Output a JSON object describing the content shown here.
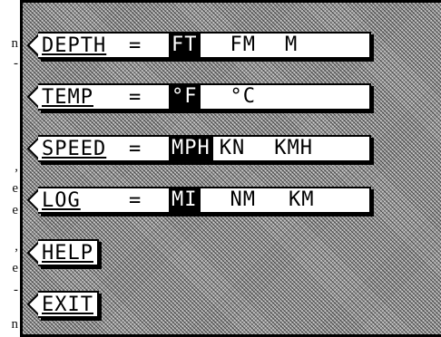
{
  "edge_text": [
    "n",
    "-",
    ",",
    "e",
    "e",
    ",",
    "e",
    "-",
    "n"
  ],
  "menu": {
    "depth": {
      "label": "DEPTH",
      "eq": "=",
      "options": [
        "FT",
        "FM",
        "M"
      ],
      "selected": "FT"
    },
    "temp": {
      "label": "TEMP",
      "eq": "=",
      "options": [
        "°F",
        "°C"
      ],
      "selected": "°F"
    },
    "speed": {
      "label": "SPEED",
      "eq": "=",
      "options": [
        "MPH",
        "KN",
        "KMH"
      ],
      "selected": "MPH"
    },
    "log": {
      "label": "LOG",
      "eq": "=",
      "options": [
        "MI",
        "NM",
        "KM"
      ],
      "selected": "MI"
    },
    "help": {
      "label": "HELP"
    },
    "exit": {
      "label": "EXIT"
    }
  },
  "colors": {
    "screen": "#9a9a9a",
    "bar": "#ffffff",
    "ink": "#000000"
  }
}
